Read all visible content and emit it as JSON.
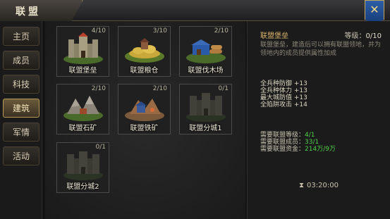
{
  "window": {
    "title": "联盟",
    "close_icon": "close-icon"
  },
  "sidebar": {
    "tabs": [
      {
        "label": "主页",
        "active": false
      },
      {
        "label": "成员",
        "active": false
      },
      {
        "label": "科技",
        "active": false
      },
      {
        "label": "建筑",
        "active": true
      },
      {
        "label": "军情",
        "active": false
      },
      {
        "label": "活动",
        "active": false
      }
    ]
  },
  "buildings": [
    {
      "name": "联盟堡垒",
      "count": "4/10",
      "locked": false
    },
    {
      "name": "联盟粮仓",
      "count": "3/10",
      "locked": false
    },
    {
      "name": "联盟伐木场",
      "count": "2/10",
      "locked": false
    },
    {
      "name": "联盟石矿",
      "count": "2/10",
      "locked": false
    },
    {
      "name": "联盟铁矿",
      "count": "2/10",
      "locked": false
    },
    {
      "name": "联盟分城1",
      "count": "0/1",
      "locked": true
    },
    {
      "name": "联盟分城2",
      "count": "0/1",
      "locked": true
    }
  ],
  "detail": {
    "name": "联盟堡垒",
    "level_label": "等级：",
    "level_value": "0/10",
    "description": "联盟堡垒，建造后可以拥有联盟领地，并为领地内的成员提供属性加成",
    "attributes": [
      "全兵种防御 +13",
      "全兵种体力 +13",
      "最大城防值 +13",
      "全陷阱攻击 +14"
    ],
    "requirements": [
      {
        "label": "需要联盟等级：",
        "value": "4/1"
      },
      {
        "label": "需要联盟成员：",
        "value": "33/1"
      },
      {
        "label": "需要联盟资金：",
        "value": "214万/9万"
      }
    ],
    "timer": "03:20:00"
  },
  "colors": {
    "accent_gold": "#d8b46a",
    "ok_green": "#4fd04a",
    "close_blue": "#2f5fa8"
  }
}
